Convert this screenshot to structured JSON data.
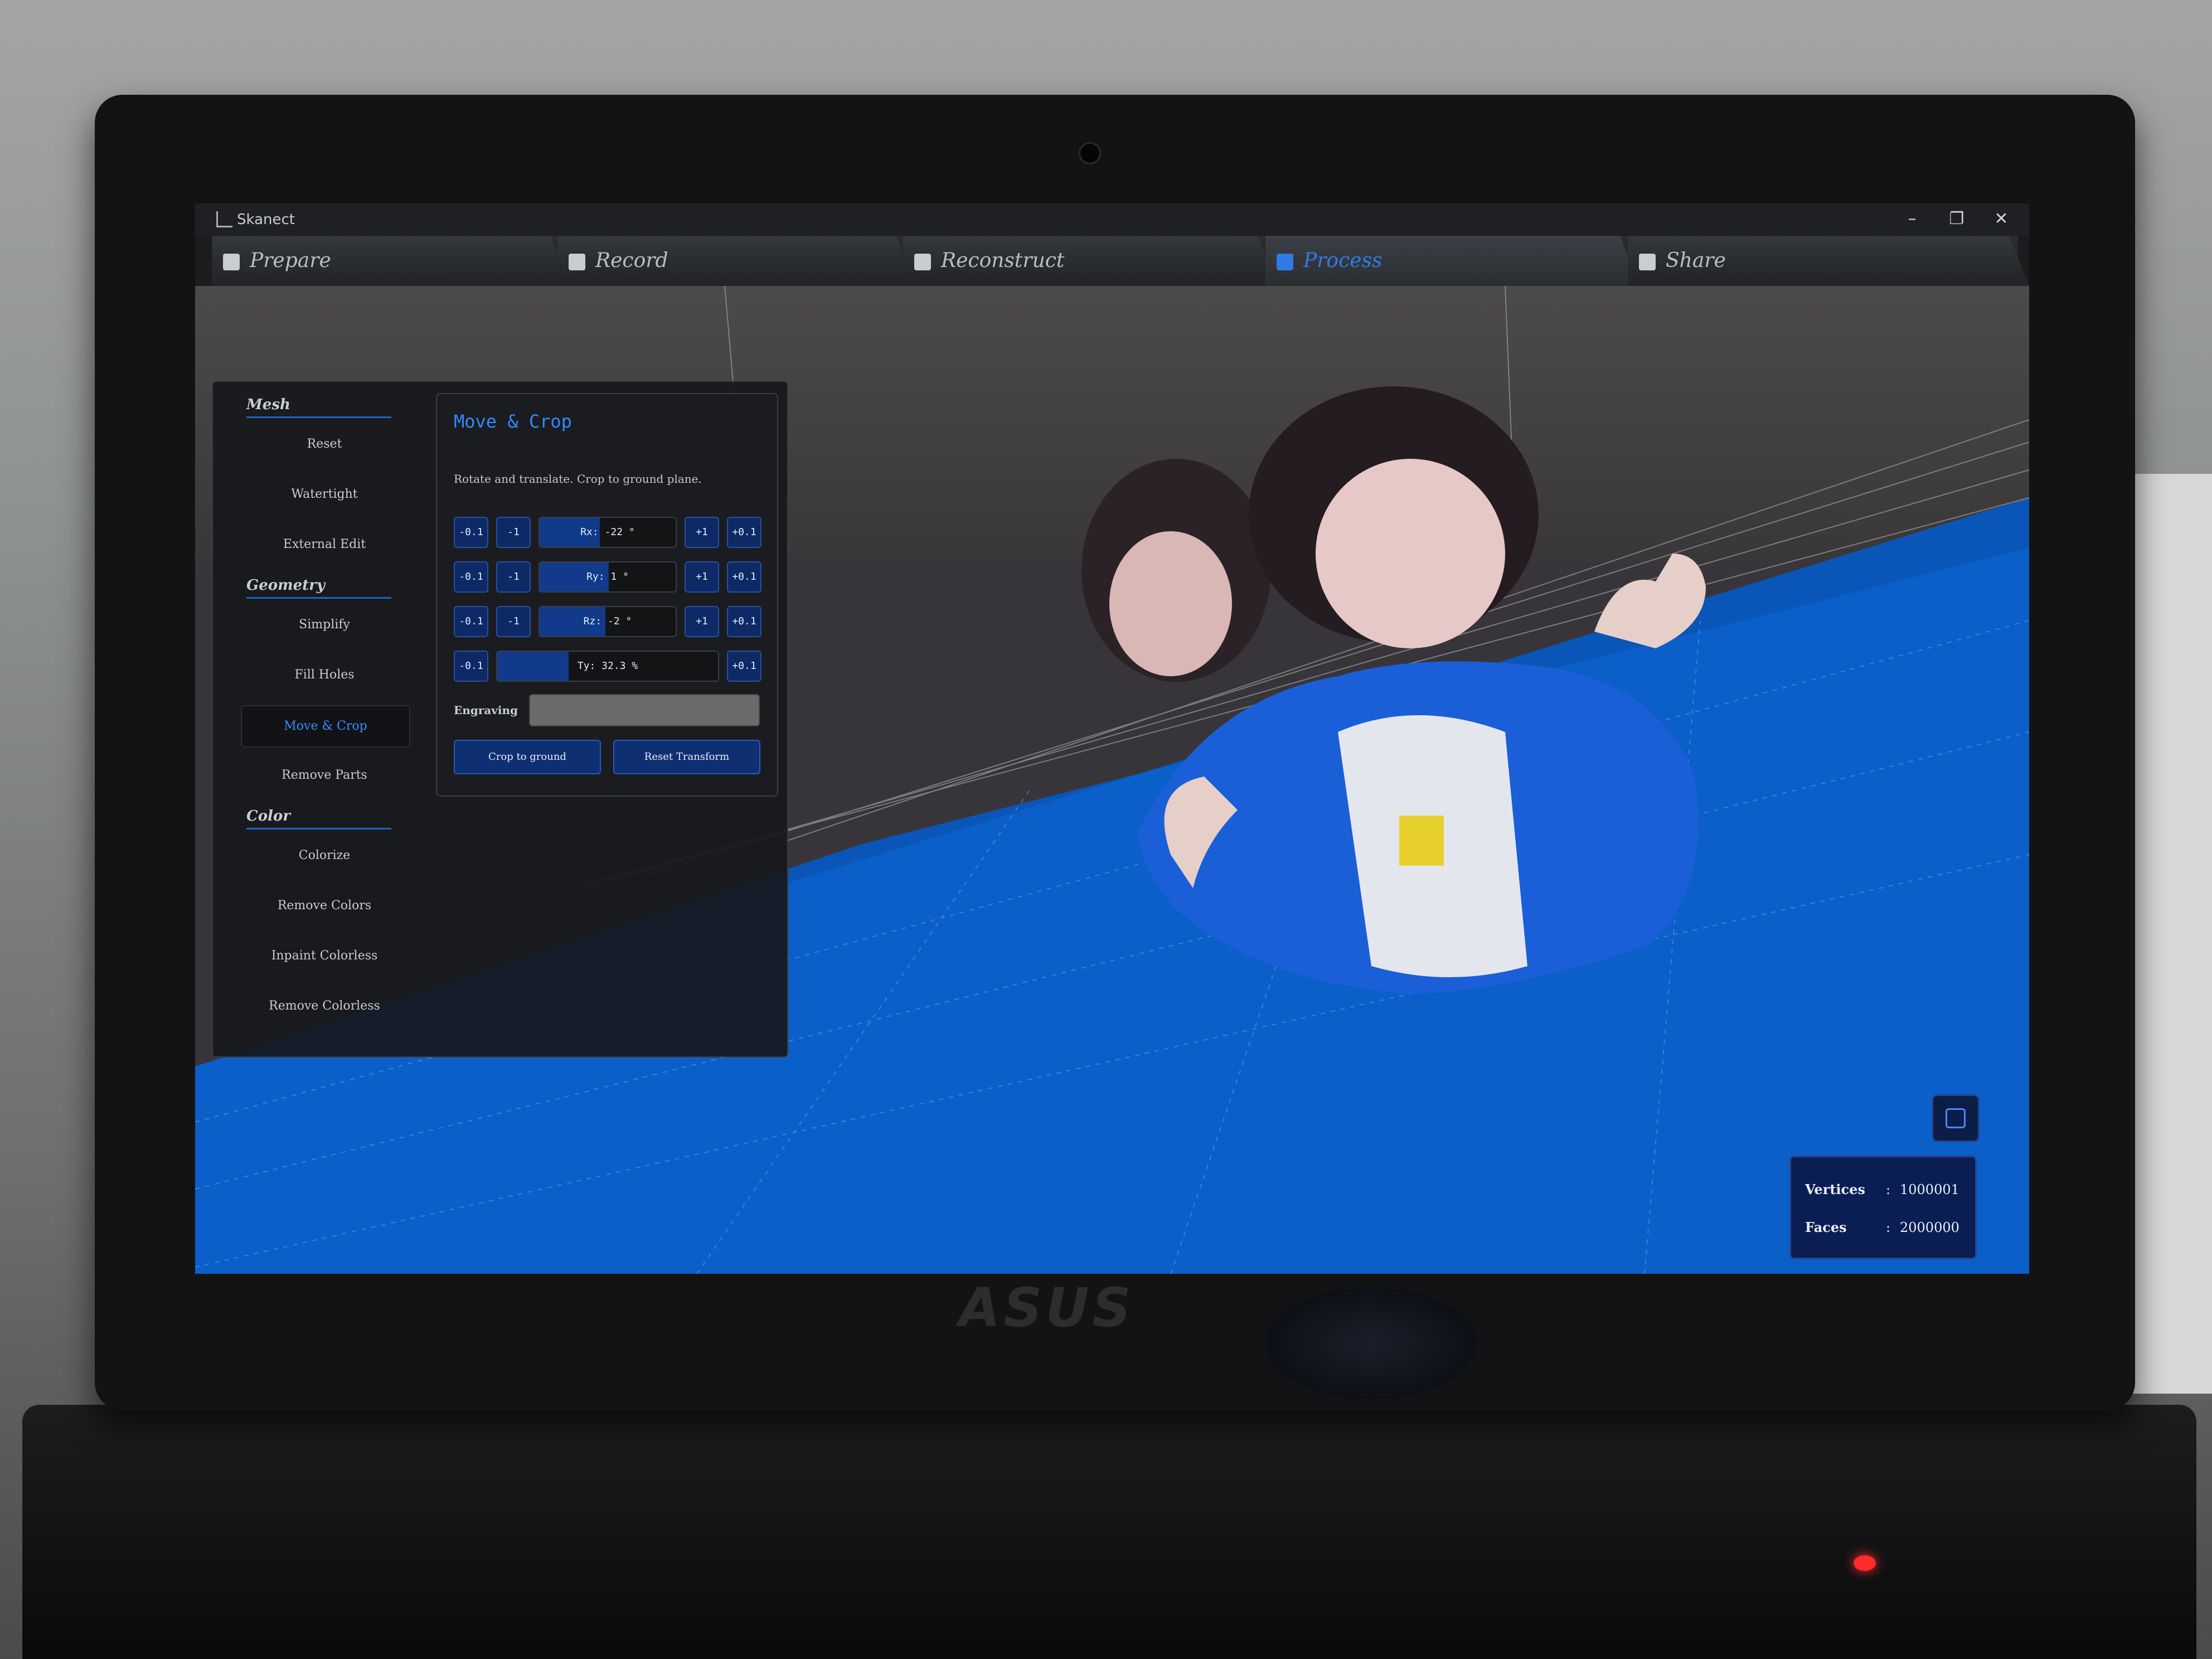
{
  "window": {
    "title": "Skanect",
    "min_glyph": "–",
    "max_glyph": "❐",
    "close_glyph": "✕"
  },
  "tabs": [
    {
      "label": "Prepare",
      "icon": "prepare-icon"
    },
    {
      "label": "Record",
      "icon": "record-icon"
    },
    {
      "label": "Reconstruct",
      "icon": "reconstruct-icon"
    },
    {
      "label": "Process",
      "icon": "gears-icon",
      "active": true
    },
    {
      "label": "Share",
      "icon": "thumbs-up-icon"
    }
  ],
  "sidebar": {
    "sections": [
      {
        "title": "Mesh",
        "items": [
          "Reset",
          "Watertight",
          "External Edit"
        ]
      },
      {
        "title": "Geometry",
        "items": [
          "Simplify",
          "Fill Holes",
          "Move & Crop",
          "Remove Parts"
        ]
      },
      {
        "title": "Color",
        "items": [
          "Colorize",
          "Remove Colors",
          "Inpaint Colorless",
          "Remove Colorless"
        ]
      }
    ],
    "active_item": "Move & Crop"
  },
  "move_crop": {
    "title": "Move & Crop",
    "description": "Rotate and translate. Crop to ground plane.",
    "step_minus_small": "-0.1",
    "step_minus_big": "-1",
    "step_plus_big": "+1",
    "step_plus_small": "+0.1",
    "rx": {
      "text": "Rx: -22 °",
      "value": -22
    },
    "ry": {
      "text": "Ry: 1 °",
      "value": 1
    },
    "rz": {
      "text": "Rz: -2 °",
      "value": -2
    },
    "ty": {
      "text": "Ty: 32.3 %",
      "value": 32.3
    },
    "engraving_label": "Engraving",
    "engraving_value": "",
    "crop_button": "Crop to ground",
    "reset_button": "Reset Transform"
  },
  "stats": {
    "vertices_label": "Vertices",
    "vertices_value": "1000001",
    "faces_label": "Faces",
    "faces_value": "2000000",
    "colon": ":"
  },
  "device": {
    "brand": "ASUS"
  },
  "colors": {
    "accent": "#2f7be8",
    "ground": "#0b5fc8",
    "panel": "#16181b"
  }
}
